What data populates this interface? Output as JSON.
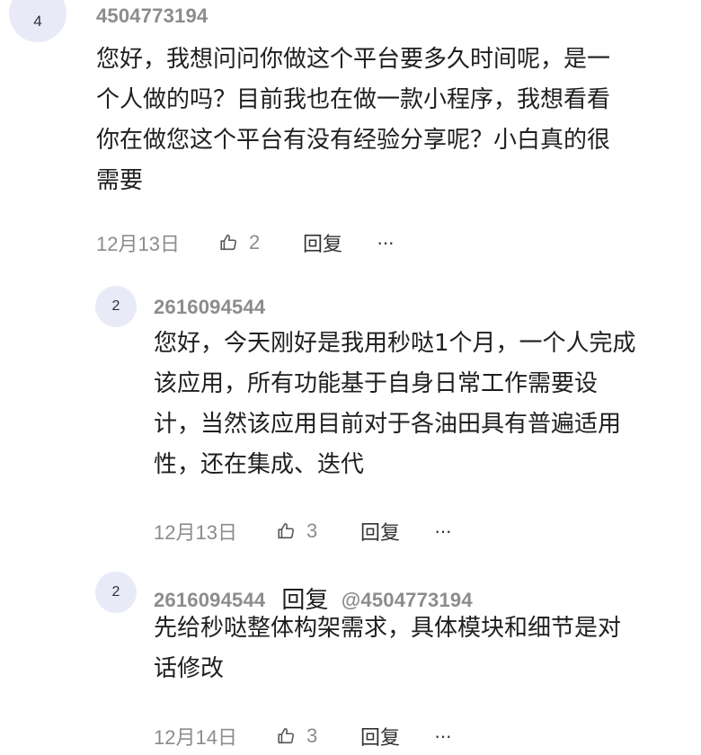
{
  "comment": {
    "avatar": "4",
    "username": "4504773194",
    "lines": [
      "您好，我想问问你做这个平台要多久时间呢，是一",
      "个人做的吗？目前我也在做一款小程序，我想看看",
      "你在做您这个平台有没有经验分享呢？小白真的很",
      "需要"
    ],
    "date": "12月13日",
    "likes": "2",
    "reply_label": "回复",
    "more_label": "···"
  },
  "replies": [
    {
      "avatar": "2",
      "username": "2616094544",
      "lines": [
        "您好，今天刚好是我用秒哒1个月，一个人完成",
        "该应用，所有功能基于自身日常工作需要设",
        "计，当然该应用目前对于各油田具有普遍适用",
        "性，还在集成、迭代"
      ],
      "date": "12月13日",
      "likes": "3",
      "reply_label": "回复",
      "more_label": "···"
    },
    {
      "avatar": "2",
      "username": "2616094544",
      "reply_to_label": "回复",
      "reply_to_user": "@4504773194",
      "lines": [
        "先给秒哒整体构架需求，具体模块和细节是对",
        "话修改"
      ],
      "date": "12月14日",
      "likes": "3",
      "reply_label": "回复",
      "more_label": "···"
    }
  ]
}
